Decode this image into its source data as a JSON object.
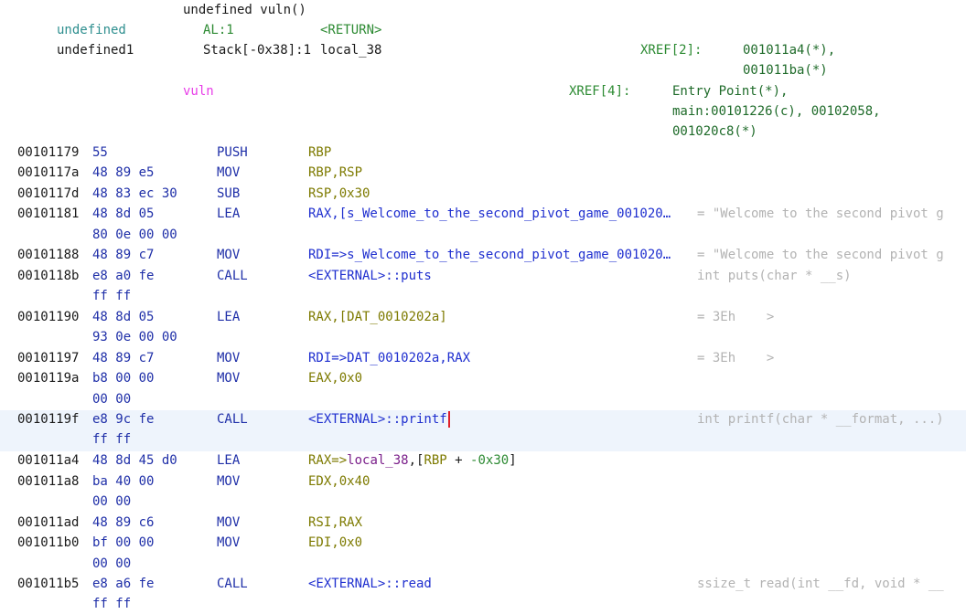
{
  "header": {
    "signature": "undefined vuln()",
    "ret_type": "undefined",
    "ret_storage": "AL:1",
    "ret_name": "<RETURN>",
    "local_type": "undefined1",
    "local_storage": "Stack[-0x38]:1",
    "local_name": "local_38",
    "local_xref_label": "XREF[2]:",
    "local_xref_1": "001011a4(*),",
    "local_xref_2": "001011ba(*)",
    "func_label": "vuln",
    "func_xref_label": "XREF[4]:",
    "func_xref_1": "Entry Point(*),",
    "func_xref_2": "main:00101226(c), 00102058,",
    "func_xref_3": "001020c8(*)"
  },
  "rows": [
    {
      "addr": "00101179",
      "bytes": "55",
      "mnem": "PUSH",
      "ops": "RBP",
      "cmt": ""
    },
    {
      "addr": "0010117a",
      "bytes": "48 89 e5",
      "mnem": "MOV",
      "ops": "RBP,RSP",
      "cmt": ""
    },
    {
      "addr": "0010117d",
      "bytes": "48 83 ec 30",
      "mnem": "SUB",
      "ops": "RSP,0x30",
      "cmt": ""
    },
    {
      "addr": "00101181",
      "bytes": "48 8d 05",
      "bytes2": "80 0e 00 00",
      "mnem": "LEA",
      "ops": "RAX,[s_Welcome_to_the_second_pivot_game_001020…",
      "cmt": "= \"Welcome to the second pivot g"
    },
    {
      "addr": "00101188",
      "bytes": "48 89 c7",
      "mnem": "MOV",
      "ops": "RDI=>s_Welcome_to_the_second_pivot_game_001020…",
      "cmt": "= \"Welcome to the second pivot g"
    },
    {
      "addr": "0010118b",
      "bytes": "e8 a0 fe",
      "bytes2": "ff ff",
      "mnem": "CALL",
      "ops": "<EXTERNAL>::puts",
      "cmt": "int puts(char * __s)"
    },
    {
      "addr": "00101190",
      "bytes": "48 8d 05",
      "bytes2": "93 0e 00 00",
      "mnem": "LEA",
      "ops": "RAX,[DAT_0010202a]",
      "cmt": "= 3Eh    >"
    },
    {
      "addr": "00101197",
      "bytes": "48 89 c7",
      "mnem": "MOV",
      "ops": "RDI=>DAT_0010202a,RAX",
      "cmt": "= 3Eh    >"
    },
    {
      "addr": "0010119a",
      "bytes": "b8 00 00",
      "bytes2": "00 00",
      "mnem": "MOV",
      "ops": "EAX,0x0",
      "cmt": ""
    },
    {
      "addr": "0010119f",
      "bytes": "e8 9c fe",
      "bytes2": "ff ff",
      "mnem": "CALL",
      "ops": "<EXTERNAL>::printf",
      "cmt": "int printf(char * __format, ...)"
    },
    {
      "addr": "001011a4",
      "bytes": "48 8d 45 d0",
      "mnem": "LEA",
      "ops": "RAX=>local_38,[RBP + -0x30]",
      "cmt": ""
    },
    {
      "addr": "001011a8",
      "bytes": "ba 40 00",
      "bytes2": "00 00",
      "mnem": "MOV",
      "ops": "EDX,0x40",
      "cmt": ""
    },
    {
      "addr": "001011ad",
      "bytes": "48 89 c6",
      "mnem": "MOV",
      "ops": "RSI,RAX",
      "cmt": ""
    },
    {
      "addr": "001011b0",
      "bytes": "bf 00 00",
      "bytes2": "00 00",
      "mnem": "MOV",
      "ops": "EDI,0x0",
      "cmt": ""
    },
    {
      "addr": "001011b5",
      "bytes": "e8 a6 fe",
      "bytes2": "ff ff",
      "mnem": "CALL",
      "ops": "<EXTERNAL>::read",
      "cmt": "ssize_t read(int __fd, void * __"
    }
  ],
  "colors": {
    "highlight": "#eef4fc",
    "cursor": "#e0202a",
    "function_label": "#e83de8",
    "xref": "#2c8a32"
  }
}
